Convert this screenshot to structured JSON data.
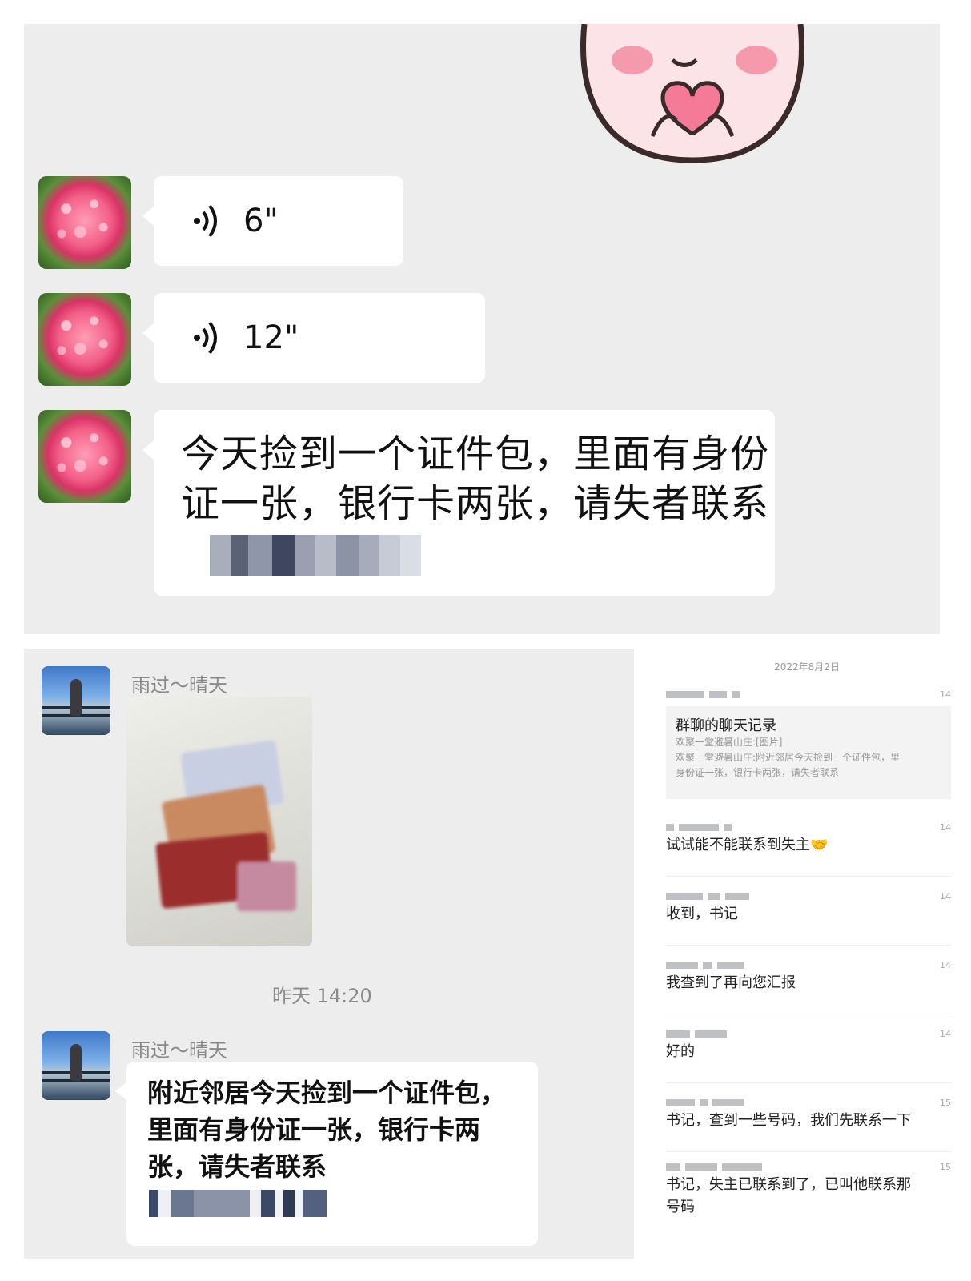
{
  "top_chat": {
    "voice_messages": [
      {
        "duration": "6\""
      },
      {
        "duration": "12\""
      }
    ],
    "text_message": {
      "lines": [
        "今天捡到一个证件包，里面有身份",
        "证一张，银行卡两张，请失者联系"
      ]
    }
  },
  "left_chat": {
    "sender_1": "雨过～晴天",
    "timestamp": "昨天 14:20",
    "sender_2": "雨过～晴天",
    "text_message": {
      "lines": [
        "附近邻居今天捡到一个证件包，",
        "里面有身份证一张，银行卡两",
        "张，请失者联系"
      ]
    }
  },
  "right_chat": {
    "date": "2022年8月2日",
    "record": {
      "title": "群聊的聊天记录",
      "line1": "欢聚一堂避暑山庄:[图片]",
      "line2": "欢聚一堂避暑山庄:附近邻居今天捡到一个证件包，里",
      "line3": "身份证一张，银行卡两张，请失者联系",
      "time": "14"
    },
    "messages": [
      {
        "text": "试试能不能联系到失主🤝",
        "time": "14"
      },
      {
        "text": "收到，书记",
        "time": "14"
      },
      {
        "text": "我查到了再向您汇报",
        "time": "14"
      },
      {
        "text": "好的",
        "time": "14"
      },
      {
        "text": "书记，查到一些号码，我们先联系一下",
        "time": "15"
      },
      {
        "text": "书记，失主已联系到了，已叫他联系那",
        "text2": "号码",
        "time": "15"
      }
    ]
  },
  "colors": {
    "chat_background": "#ededed",
    "bubble": "#ffffff",
    "muted_text": "#8a8a8a",
    "sticker_pink": "#f7c8d3"
  },
  "icons": [
    "voice-wave-icon",
    "flower-avatar-icon",
    "person-avatar-icon",
    "heart-sticker-icon"
  ]
}
